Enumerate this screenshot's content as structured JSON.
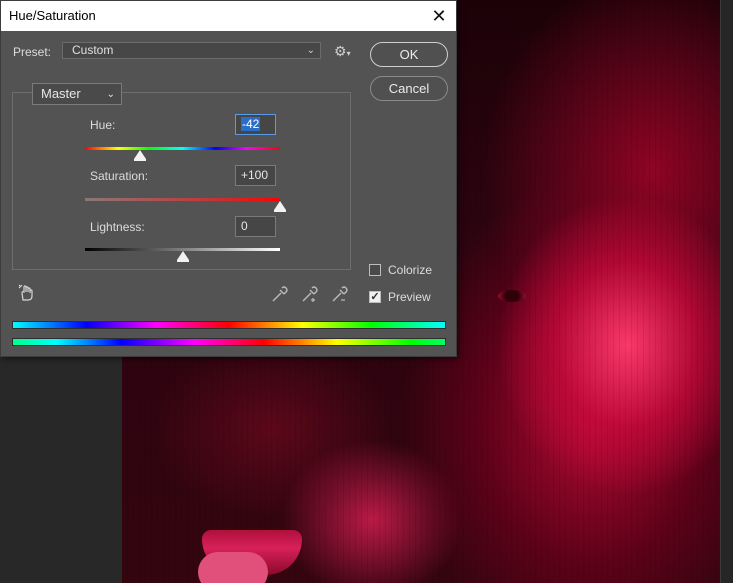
{
  "dialog": {
    "title": "Hue/Saturation",
    "preset_label": "Preset:",
    "preset_value": "Custom",
    "ok_label": "OK",
    "cancel_label": "Cancel",
    "channel": "Master",
    "hue": {
      "label": "Hue:",
      "value": "-42",
      "slider_fraction": 0.283
    },
    "saturation": {
      "label": "Saturation:",
      "value": "+100",
      "slider_fraction": 1.0
    },
    "lightness": {
      "label": "Lightness:",
      "value": "0",
      "slider_fraction": 0.5
    },
    "colorize": {
      "label": "Colorize",
      "checked": false
    },
    "preview": {
      "label": "Preview",
      "checked": true
    }
  },
  "icons": {
    "close": "close-icon",
    "gear": "gear-icon",
    "chevron": "chevron-down-icon",
    "hand": "targeted-adjustment-hand-icon",
    "eyedropper": "eyedropper-icon",
    "eyedropper_plus": "eyedropper-plus-icon",
    "eyedropper_minus": "eyedropper-minus-icon"
  },
  "colors": {
    "dialog_bg": "#535353",
    "focus_blue": "#2a6ec8",
    "photo_tint": "#d0204f"
  }
}
